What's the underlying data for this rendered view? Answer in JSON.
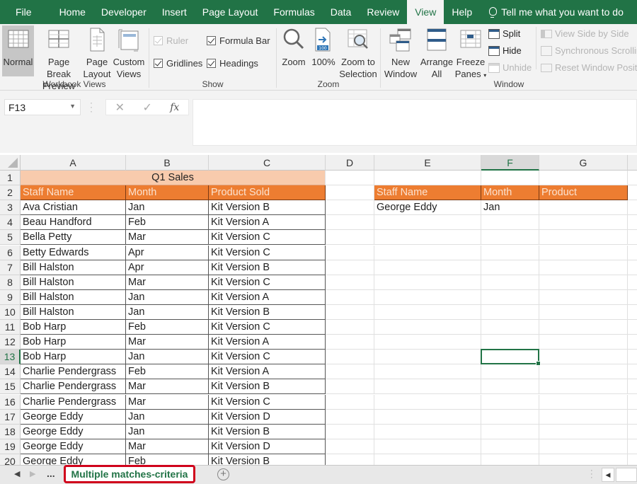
{
  "menu": {
    "tabs": [
      "File",
      "Home",
      "Developer",
      "Insert",
      "Page Layout",
      "Formulas",
      "Data",
      "Review",
      "View",
      "Help"
    ],
    "active_tab": "View",
    "tell_me": "Tell me what you want to do"
  },
  "ribbon": {
    "workbook_views": {
      "label": "Workbook Views",
      "normal": "Normal",
      "page_break_1": "Page Break",
      "page_break_2": "Preview",
      "page_layout_1": "Page",
      "page_layout_2": "Layout",
      "custom_views_1": "Custom",
      "custom_views_2": "Views"
    },
    "show": {
      "label": "Show",
      "ruler": "Ruler",
      "formula_bar": "Formula Bar",
      "gridlines": "Gridlines",
      "headings": "Headings"
    },
    "zoom": {
      "label": "Zoom",
      "zoom": "Zoom",
      "hundred": "100%",
      "hundred_icon_text": "100",
      "zoom_sel_1": "Zoom to",
      "zoom_sel_2": "Selection"
    },
    "window": {
      "label": "Window",
      "new_window_1": "New",
      "new_window_2": "Window",
      "arrange_1": "Arrange",
      "arrange_2": "All",
      "freeze_1": "Freeze",
      "freeze_2": "Panes",
      "split": "Split",
      "hide": "Hide",
      "unhide": "Unhide",
      "side_by_side": "View Side by Side",
      "sync_scroll": "Synchronous Scrolling",
      "reset_pos": "Reset Window Position"
    }
  },
  "formula_bar": {
    "name_box": "F13",
    "cancel": "✕",
    "enter": "✓",
    "fx": "fx",
    "value": ""
  },
  "sheet": {
    "columns": [
      "A",
      "B",
      "C",
      "D",
      "E",
      "F",
      "G"
    ],
    "selected_cell": "F13",
    "title": "Q1 Sales",
    "table_headers": [
      "Staff Name",
      "Month",
      "Product Sold"
    ],
    "rows": [
      [
        "Ava Cristian",
        "Jan",
        "Kit Version B"
      ],
      [
        "Beau Handford",
        "Feb",
        "Kit Version A"
      ],
      [
        "Bella Petty",
        "Mar",
        "Kit Version C"
      ],
      [
        "Betty Edwards",
        "Apr",
        "Kit Version C"
      ],
      [
        "Bill Halston",
        "Apr",
        "Kit Version B"
      ],
      [
        "Bill Halston",
        "Mar",
        "Kit Version C"
      ],
      [
        "Bill Halston",
        "Jan",
        "Kit Version A"
      ],
      [
        "Bill Halston",
        "Jan",
        "Kit Version B"
      ],
      [
        "Bob Harp",
        "Feb",
        "Kit Version C"
      ],
      [
        "Bob Harp",
        "Mar",
        "Kit Version A"
      ],
      [
        "Bob Harp",
        "Jan",
        "Kit Version C"
      ],
      [
        "Charlie Pendergrass",
        "Feb",
        "Kit Version A"
      ],
      [
        "Charlie Pendergrass",
        "Mar",
        "Kit Version B"
      ],
      [
        "Charlie Pendergrass",
        "Mar",
        "Kit Version C"
      ],
      [
        "George Eddy",
        "Jan",
        "Kit Version D"
      ],
      [
        "George Eddy",
        "Jan",
        "Kit Version B"
      ],
      [
        "George Eddy",
        "Mar",
        "Kit Version D"
      ],
      [
        "George Eddy",
        "Feb",
        "Kit Version B"
      ]
    ],
    "lookup_headers": [
      "Staff Name",
      "Month",
      "Product"
    ],
    "lookup_values": [
      "George Eddy",
      "Jan",
      ""
    ]
  },
  "tabs_bar": {
    "prev": "◀",
    "next": "▶",
    "more": "...",
    "active_sheet": "Multiple matches-criteria",
    "add": "+"
  },
  "colors": {
    "excel_green": "#217346",
    "header_orange": "#ed7d31",
    "title_peach": "#f8cbad",
    "tab_highlight_red": "#d0021b"
  }
}
